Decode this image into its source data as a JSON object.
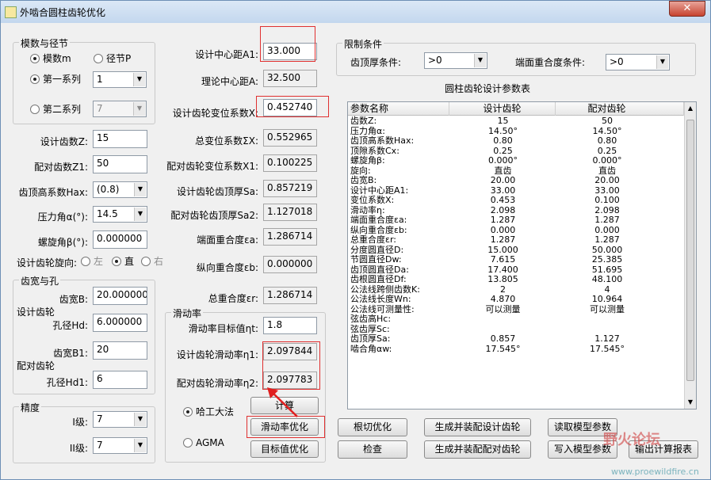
{
  "window": {
    "title": "外啮合圆柱齿轮优化",
    "close": "✕"
  },
  "module_group": {
    "title": "模数与径节",
    "opt_module": "模数m",
    "opt_pitch": "径节P",
    "opt_series1": "第一系列",
    "series1_value": "1",
    "opt_series2": "第二系列",
    "series2_value": "7"
  },
  "left": {
    "z_label": "设计齿数Z:",
    "z_value": "15",
    "z1_label": "配对齿数Z1:",
    "z1_value": "50",
    "hax_label": "齿顶高系数Hax:",
    "hax_value": "(0.8)",
    "alpha_label": "压力角α(°):",
    "alpha_value": "14.5",
    "beta_label": "螺旋角β(°):",
    "beta_value": "0.000000",
    "dir_label": "设计齿轮旋向:",
    "dir_left": "左",
    "dir_straight": "直",
    "dir_right": "右"
  },
  "width_group": {
    "title": "齿宽与孔",
    "b_label": "齿宽B:",
    "b_value": "20.000000",
    "design_gear": "设计齿轮",
    "hd_label": "孔径Hd:",
    "hd_value": "6.000000",
    "b1_label": "齿宽B1:",
    "b1_value": "20",
    "pair_gear": "配对齿轮",
    "hd1_label": "孔径Hd1:",
    "hd1_value": "6"
  },
  "precision_group": {
    "title": "精度",
    "i_label": "I级:",
    "i_value": "7",
    "ii_label": "II级:",
    "ii_value": "7"
  },
  "middle": {
    "a1_label": "设计中心距A1:",
    "a1_value": "33.000",
    "a_label": "理论中心距A:",
    "a_value": "32.500",
    "x_label": "设计齿轮变位系数X:",
    "x_value": "0.452740",
    "sx_label": "总变位系数ΣX:",
    "sx_value": "0.552965",
    "x1_label": "配对齿轮变位系数X1:",
    "x1_value": "0.100225",
    "sa_label": "设计齿轮齿顶厚Sa:",
    "sa_value": "0.857219",
    "sa2_label": "配对齿轮齿顶厚Sa2:",
    "sa2_value": "1.127018",
    "ea_label": "端面重合度εa:",
    "ea_value": "1.286714",
    "eb_label": "纵向重合度εb:",
    "eb_value": "0.000000",
    "er_label": "总重合度εr:",
    "er_value": "1.286714"
  },
  "slip_group": {
    "title": "滑动率",
    "target_label": "滑动率目标值ηt:",
    "target_value": "1.8",
    "eta1_label": "设计齿轮滑动率η1:",
    "eta1_value": "2.097844",
    "eta2_label": "配对齿轮滑动率η2:",
    "eta2_value": "2.097783",
    "opt_hit": "哈工大法",
    "opt_agma": "AGMA",
    "btn_calc": "计算",
    "btn_slip_opt": "滑动率优化",
    "btn_target_opt": "目标值优化"
  },
  "limits": {
    "title": "限制条件",
    "tip_label": "齿顶厚条件:",
    "tip_value": ">0",
    "overlap_label": "端面重合度条件:",
    "overlap_value": ">0"
  },
  "table": {
    "title": "圆柱齿轮设计参数表",
    "headers": [
      "参数名称",
      "设计齿轮",
      "配对齿轮"
    ],
    "rows": [
      [
        "齿数Z:",
        "15",
        "50"
      ],
      [
        "压力角α:",
        "14.50°",
        "14.50°"
      ],
      [
        "齿顶高系数Hax:",
        "0.80",
        "0.80"
      ],
      [
        "顶隙系数Cx:",
        "0.25",
        "0.25"
      ],
      [
        "螺旋角β:",
        "0.000°",
        "0.000°"
      ],
      [
        "旋向:",
        "直齿",
        "直齿"
      ],
      [
        "齿宽B:",
        "20.00",
        "20.00"
      ],
      [
        "设计中心距A1:",
        "33.00",
        "33.00"
      ],
      [
        "变位系数X:",
        "0.453",
        "0.100"
      ],
      [
        "滑动率η:",
        "2.098",
        "2.098"
      ],
      [
        "端面重合度εa:",
        "1.287",
        "1.287"
      ],
      [
        "纵向重合度εb:",
        "0.000",
        "0.000"
      ],
      [
        "总重合度εr:",
        "1.287",
        "1.287"
      ],
      [
        "分度圆直径D:",
        "15.000",
        "50.000"
      ],
      [
        "节圆直径Dw:",
        "7.615",
        "25.385"
      ],
      [
        "齿顶圆直径Da:",
        "17.400",
        "51.695"
      ],
      [
        "齿根圆直径Df:",
        "13.805",
        "48.100"
      ],
      [
        "公法线跨侧齿数K:",
        "2",
        "4"
      ],
      [
        "公法线长度Wn:",
        "4.870",
        "10.964"
      ],
      [
        "公法线可测量性:",
        "可以测量",
        "可以测量"
      ],
      [
        "弦齿高Hc:",
        "",
        ""
      ],
      [
        "弦齿厚Sc:",
        "",
        ""
      ],
      [
        "齿顶厚Sa:",
        "0.857",
        "1.127"
      ],
      [
        "啮合角αw:",
        "17.545°",
        "17.545°"
      ]
    ]
  },
  "buttons": {
    "root_cut": "根切优化",
    "gen_design": "生成并装配设计齿轮",
    "read_model": "读取模型参数",
    "check": "检查",
    "gen_pair": "生成并装配配对齿轮",
    "write_model": "写入模型参数",
    "export": "输出计算报表"
  },
  "watermark": {
    "text": "野火论坛",
    "url": "www.proewildfire.cn"
  }
}
